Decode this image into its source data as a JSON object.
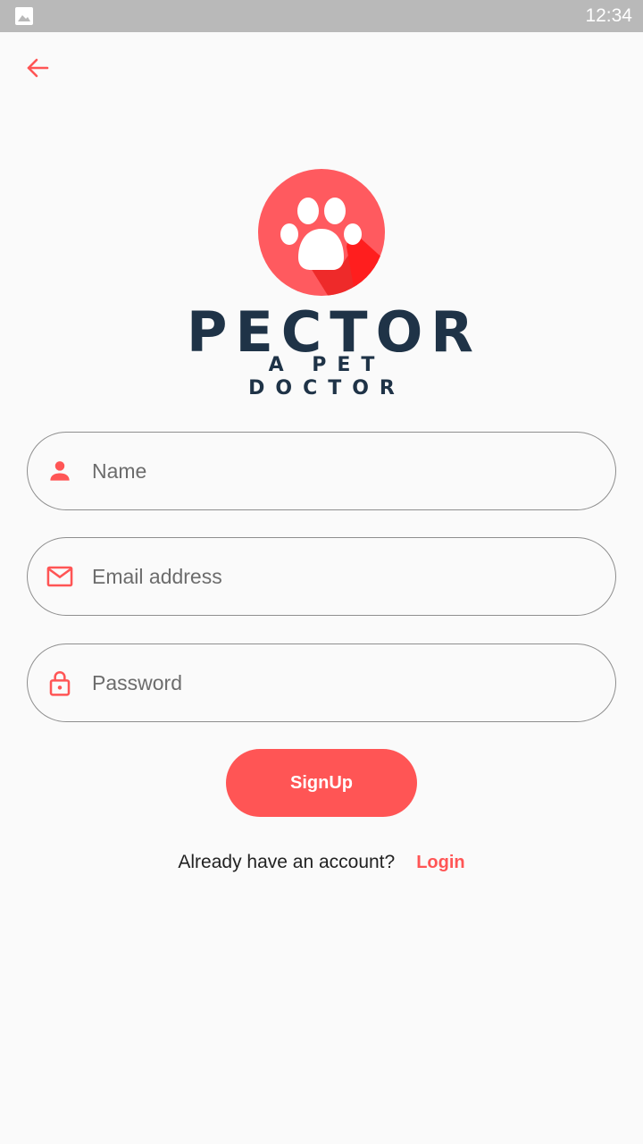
{
  "status_bar": {
    "time": "12:34",
    "image_icon": "image-icon"
  },
  "header": {
    "back_icon": "arrow-back-icon"
  },
  "logo": {
    "title": "PECTOR",
    "subtitle": "A PET DOCTOR",
    "icon": "paw-icon"
  },
  "form": {
    "name": {
      "placeholder": "Name",
      "value": "",
      "icon": "person-icon"
    },
    "email": {
      "placeholder": "Email address",
      "value": "",
      "icon": "mail-icon"
    },
    "password": {
      "placeholder": "Password",
      "value": "",
      "icon": "lock-icon"
    }
  },
  "signup_label": "SignUp",
  "login_prompt": {
    "text": "Already have an account?",
    "link": "Login"
  },
  "colors": {
    "accent": "#ff5555",
    "brand_text": "#1f3347",
    "background": "#fafafa",
    "status_bar": "#b9b9b9"
  }
}
